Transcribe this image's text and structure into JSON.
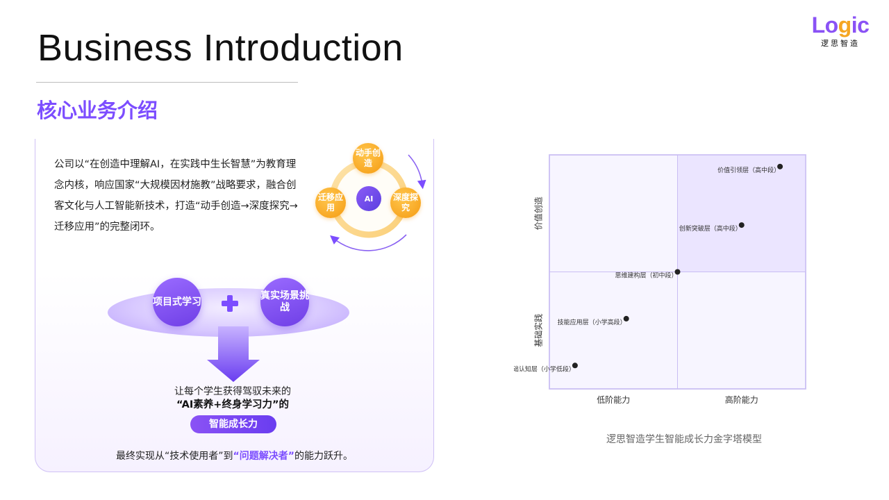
{
  "header": {
    "title": "Business Introduction",
    "subtitle": "核心业务介绍",
    "logo_word": [
      "Lo",
      "g",
      "ic"
    ],
    "logo_cn": "逻思智造"
  },
  "intro": {
    "text": "公司以“在创造中理解AI，在实践中生长智慧”为教育理念内核，响应国家“大规模因材施教”战略要求，融合创客文化与人工智能新技术，打造“动手创造→深度探究→迁移应用”的完整闭环。"
  },
  "cycle": {
    "create": "动手创造",
    "deep": "深度探究",
    "apply": "迁移应用",
    "center": "AI",
    "colors": {
      "accent": "#f59b12",
      "primary": "#7c4dff"
    }
  },
  "learning": {
    "left": "项目式学习",
    "right": "真实场景挑战"
  },
  "goal": {
    "line1": "让每个学生获得驾驭未来的",
    "line2": "“AI素养+终身学习力”的",
    "pill": "智能成长力"
  },
  "final": {
    "prefix": "最终实现从“技术使用者”到",
    "highlight": "“问题解决者”",
    "suffix": "的能力跃升。"
  },
  "chart_data": {
    "type": "scatter",
    "title": "",
    "x_categories": [
      "低阶能力",
      "高阶能力"
    ],
    "y_categories": [
      "基础实践",
      "价值创造"
    ],
    "xlim": [
      0,
      1
    ],
    "ylim": [
      0,
      1
    ],
    "grid": true,
    "points": [
      {
        "label": "价值引领层（高中段）",
        "x": 0.9,
        "y": 0.95
      },
      {
        "label": "创新突破层（高中段）",
        "x": 0.75,
        "y": 0.7
      },
      {
        "label": "思维建构层（初中段）",
        "x": 0.5,
        "y": 0.5
      },
      {
        "label": "技能应用层（小学高段）",
        "x": 0.3,
        "y": 0.3
      },
      {
        "label": "基础认知层（小学低段）",
        "x": 0.1,
        "y": 0.1
      }
    ],
    "caption": "逻思智造学生智能成长力金字塔模型"
  }
}
